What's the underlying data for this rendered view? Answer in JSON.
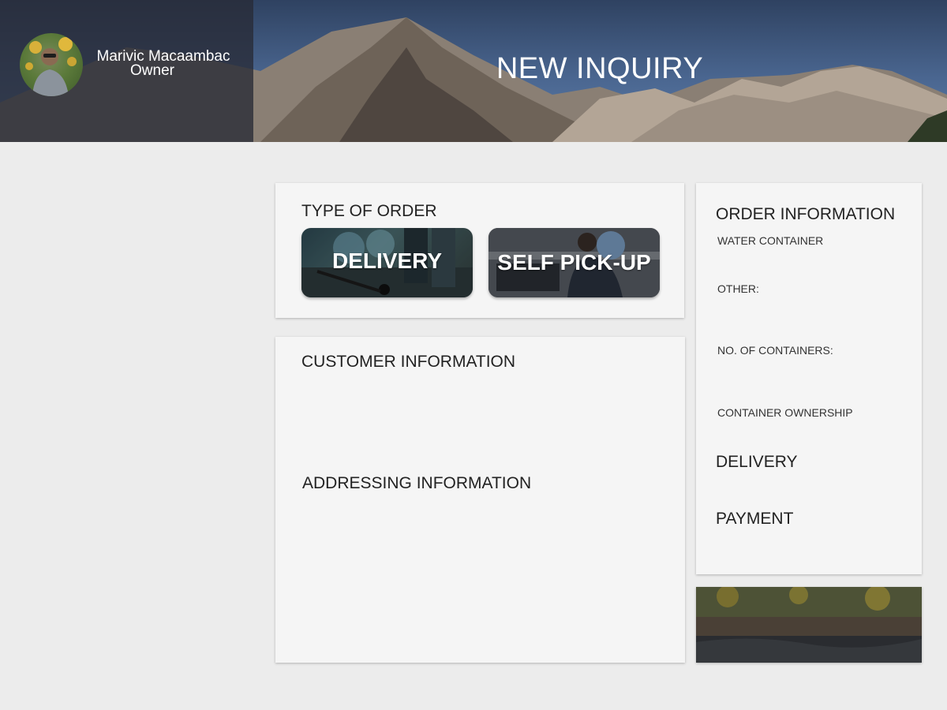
{
  "header": {
    "title": "NEW INQUIRY",
    "user": {
      "name": "Marivic Macaambac",
      "role": "Owner"
    }
  },
  "order_type": {
    "title": "TYPE OF ORDER",
    "options": [
      {
        "label": "DELIVERY"
      },
      {
        "label": "SELF PICK-UP"
      }
    ]
  },
  "customer": {
    "title": "CUSTOMER INFORMATION",
    "address_title": "ADDRESSING INFORMATION"
  },
  "order_info": {
    "title": "ORDER INFORMATION",
    "fields": {
      "water_container": "WATER CONTAINER",
      "other": "OTHER:",
      "containers": "NO. OF CONTAINERS:",
      "ownership": "CONTAINER OWNERSHIP"
    },
    "delivery_title": "DELIVERY",
    "payment_title": "PAYMENT"
  }
}
